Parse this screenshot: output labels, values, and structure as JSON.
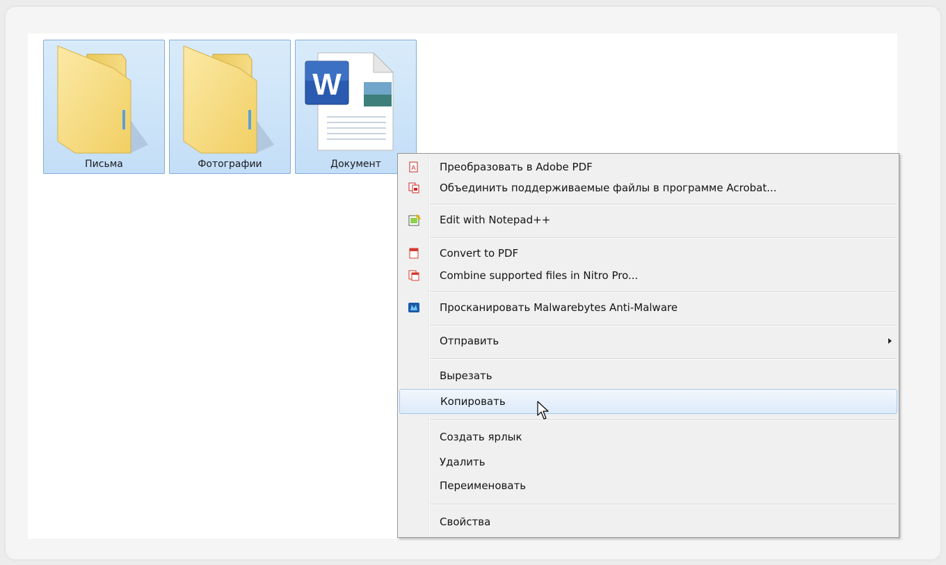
{
  "files": [
    {
      "label": "Письма",
      "icon": "folder-icon"
    },
    {
      "label": "Фотографии",
      "icon": "folder-icon"
    },
    {
      "label": "Документ",
      "icon": "word-document-icon"
    }
  ],
  "context_menu": {
    "items": [
      {
        "label": "Преобразовать в Adobe PDF",
        "icon": "adobe-pdf-icon"
      },
      {
        "label": "Объединить поддерживаемые файлы в программе Acrobat...",
        "icon": "acrobat-combine-icon"
      },
      {
        "label": "Edit with Notepad++",
        "icon": "notepad-plus-plus-icon"
      },
      {
        "label": "Convert to PDF",
        "icon": "nitro-pdf-icon"
      },
      {
        "label": "Combine supported files in Nitro Pro...",
        "icon": "nitro-combine-icon"
      },
      {
        "label": "Просканировать Malwarebytes Anti-Malware",
        "icon": "malwarebytes-icon"
      },
      {
        "label": "Отправить",
        "icon": "submenu-arrow-icon"
      },
      {
        "label": "Вырезать"
      },
      {
        "label": "Копировать",
        "state": "hovered"
      },
      {
        "label": "Создать ярлык"
      },
      {
        "label": "Удалить"
      },
      {
        "label": "Переименовать"
      },
      {
        "label": "Свойства"
      }
    ]
  },
  "colors": {
    "selection_fill": "#cce4f7",
    "selection_border": "#84acdd",
    "menu_bg": "#f0f0f0",
    "hover_border": "#a8c8ec"
  }
}
